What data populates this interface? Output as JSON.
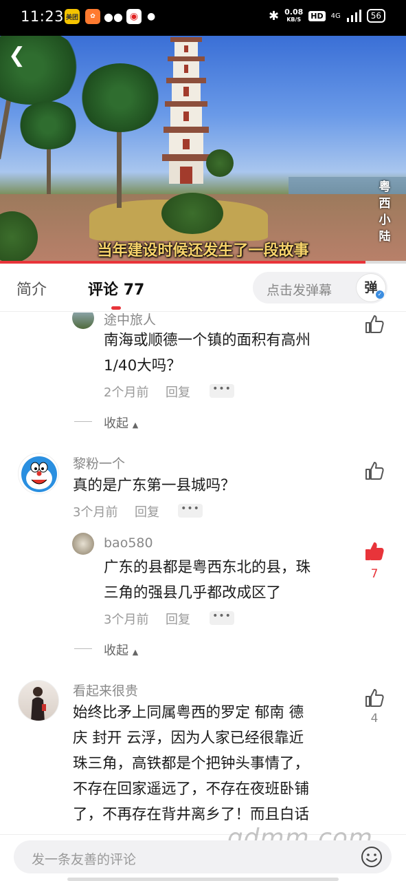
{
  "status_bar": {
    "time": "11:23",
    "network_speed": "0.08",
    "network_unit": "KB/S",
    "hd": "HD",
    "signal": "4G",
    "battery": "56"
  },
  "video": {
    "subtitle": "当年建设时候还发生了一段故事",
    "channel_watermark": "粤西小陆",
    "progress_fraction": 0.9
  },
  "tabs": {
    "intro": "简介",
    "comments": "评论",
    "comment_count": "77",
    "danmaku_placeholder": "点击发弹幕",
    "danmaku_button": "弹"
  },
  "comments": [
    {
      "user": "途中旅人",
      "text_line1": "南海或顺德一个镇的面积有高州",
      "text_line2": "1/40大吗？",
      "time": "2个月前",
      "reply": "回复",
      "more": "•••",
      "collapse": "收起"
    },
    {
      "user": "黎粉一个",
      "text_line1": "真的是广东第一县城吗？",
      "time": "3个月前",
      "reply": "回复",
      "more": "•••"
    },
    {
      "user": "bao580",
      "text_line1": "广东的县都是粤西东北的县，珠",
      "text_line2": "三角的强县几乎都改成区了",
      "time": "3个月前",
      "reply": "回复",
      "more": "•••",
      "likes": "7",
      "collapse": "收起"
    },
    {
      "user": "看起来很贵",
      "text_line1": "始终比矛上同属粤西的罗定 郁南 德",
      "text_line2": "庆 封开 云浮，因为人家已经很靠近",
      "text_line3": "珠三角，高铁都是个把钟头事情了，",
      "text_line4": "不存在回家遥远了，不存在夜班卧铺",
      "text_line5": "了，不再存在背井离乡了！而且白话",
      "likes": "4"
    }
  ],
  "bottom": {
    "input_placeholder": "发一条友善的评论",
    "site_watermark": "gdmm.com"
  },
  "colors": {
    "accent": "#e8343a",
    "subtitle": "#f7d36b"
  }
}
